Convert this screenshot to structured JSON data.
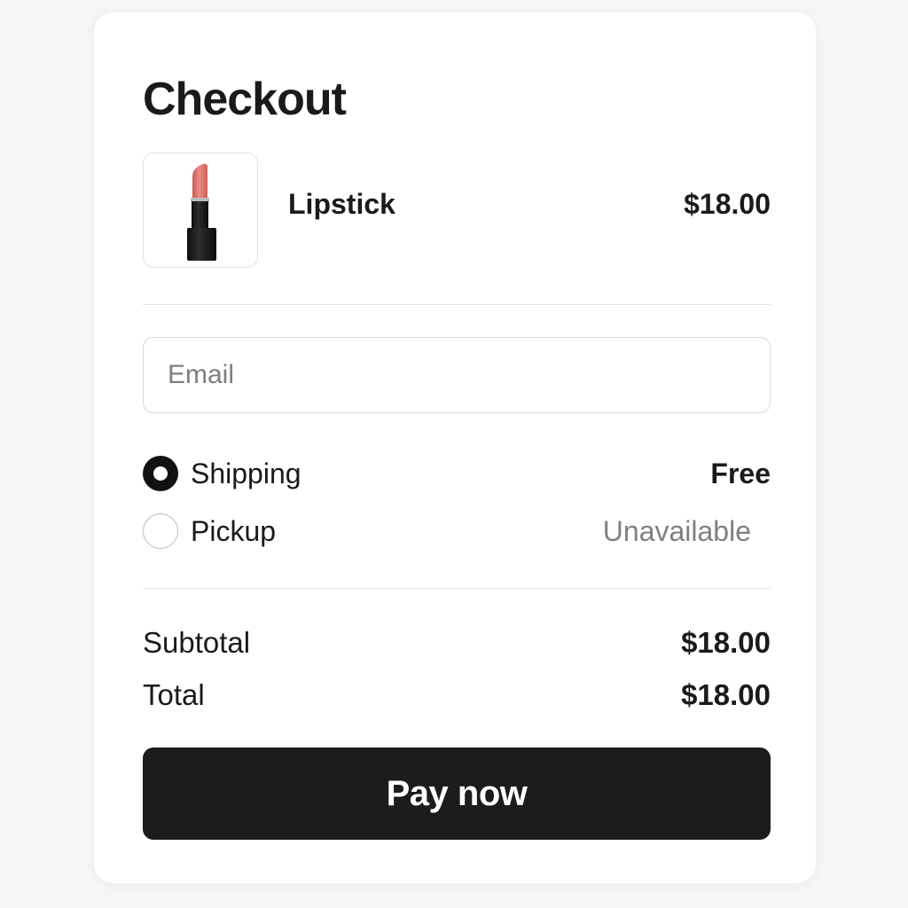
{
  "checkout": {
    "title": "Checkout"
  },
  "product": {
    "name": "Lipstick",
    "price": "$18.00",
    "image_icon": "lipstick-icon"
  },
  "email": {
    "placeholder": "Email",
    "value": ""
  },
  "delivery_options": [
    {
      "label": "Shipping",
      "value": "Free",
      "selected": true
    },
    {
      "label": "Pickup",
      "value": "Unavailable",
      "selected": false
    }
  ],
  "summary": {
    "subtotal_label": "Subtotal",
    "subtotal_value": "$18.00",
    "total_label": "Total",
    "total_value": "$18.00"
  },
  "pay_button": {
    "label": "Pay now"
  },
  "colors": {
    "page_background": "#f6f6f6",
    "card_background": "#ffffff",
    "button_background": "#1c1c1c",
    "button_text": "#ffffff",
    "muted_text": "#808080",
    "lipstick_bullet": "#e47a72",
    "lipstick_case": "#1b1b1b"
  }
}
